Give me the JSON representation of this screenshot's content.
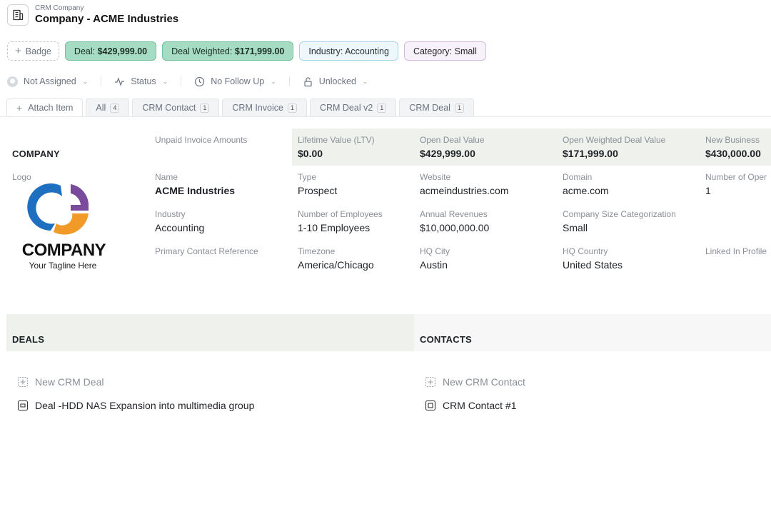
{
  "header": {
    "breadcrumb": "CRM Company",
    "title": "Company - ACME Industries",
    "icon": "building-icon"
  },
  "badges": {
    "add_label": "Badge",
    "deal_prefix": "Deal: ",
    "deal_value": "$429,999.00",
    "weighted_prefix": "Deal Weighted: ",
    "weighted_value": "$171,999.00",
    "industry": "Industry: Accounting",
    "category": "Category: Small",
    "colors": {
      "green": "#a7dcc4",
      "blue": "#eef7fc",
      "purple": "#f7f1fa"
    }
  },
  "status": {
    "assignee": "Not Assigned",
    "status": "Status",
    "follow_up": "No Follow Up",
    "lock": "Unlocked"
  },
  "tabs": {
    "attach": "Attach Item",
    "items": [
      {
        "label": "All",
        "count": "4"
      },
      {
        "label": "CRM Contact",
        "count": "1"
      },
      {
        "label": "CRM Invoice",
        "count": "1"
      },
      {
        "label": "CRM Deal v2",
        "count": "1"
      },
      {
        "label": "CRM Deal",
        "count": "1"
      }
    ]
  },
  "company": {
    "section_title": "COMPANY",
    "logo_label": "Logo",
    "logo_word": "COMPANY",
    "logo_tagline": "Your Tagline Here",
    "summary": {
      "unpaid_label": "Unpaid Invoice Amounts",
      "ltv_label": "Lifetime Value (LTV)",
      "ltv_value": "$0.00",
      "open_deal_label": "Open Deal Value",
      "open_deal_value": "$429,999.00",
      "weighted_label": "Open Weighted Deal Value",
      "weighted_value": "$171,999.00",
      "new_business_label": "New Business",
      "new_business_value": "$430,000.00"
    },
    "fields": {
      "name_label": "Name",
      "name_value": "ACME Industries",
      "type_label": "Type",
      "type_value": "Prospect",
      "website_label": "Website",
      "website_value": "acmeindustries.com",
      "domain_label": "Domain",
      "domain_value": "acme.com",
      "open_label": "Number of Oper",
      "open_value": "1",
      "industry_label": "Industry",
      "industry_value": "Accounting",
      "employees_label": "Number of Employees",
      "employees_value": "1-10 Employees",
      "revenue_label": "Annual Revenues",
      "revenue_value": "$10,000,000.00",
      "size_label": "Company Size Categorization",
      "size_value": "Small",
      "primary_label": "Primary Contact Reference",
      "timezone_label": "Timezone",
      "timezone_value": "America/Chicago",
      "city_label": "HQ City",
      "city_value": "Austin",
      "country_label": "HQ Country",
      "country_value": "United States",
      "linkedin_label": "Linked In Profile"
    }
  },
  "deals": {
    "title": "DEALS",
    "new_label": "New CRM Deal",
    "items": [
      "Deal -HDD NAS Expansion into multimedia group"
    ]
  },
  "contacts": {
    "title": "CONTACTS",
    "new_label": "New CRM Contact",
    "items": [
      "CRM Contact #1"
    ]
  }
}
